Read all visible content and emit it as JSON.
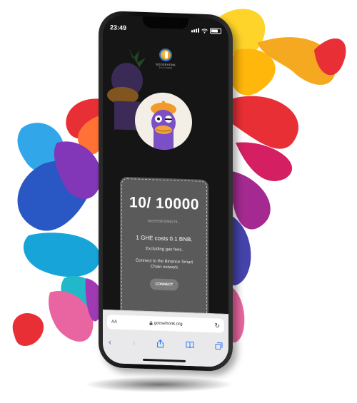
{
  "status_bar": {
    "time": "23:49"
  },
  "header": {
    "logo_title": "GOOSEHONK",
    "logo_subtitle": "EXCLUSIVES"
  },
  "mint_card": {
    "counter": "10/ 10000",
    "address": "0xc5755F3055274...",
    "price_text": "1 GHE costs 0.1 BNB.",
    "gas_text": "Excluding gas fees.",
    "network_text": "Connect to the Binance Smart Chain network",
    "connect_label": "CONNECT"
  },
  "browser": {
    "text_size_label": "AA",
    "url": "goosehonk.org",
    "toolbar_icons": [
      "back-icon",
      "forward-icon",
      "share-icon",
      "bookmarks-icon",
      "tabs-icon"
    ]
  },
  "colors": {
    "card_bg": "#5a5a5a",
    "screen_bg": "#151515",
    "ios_blue": "#3478f6",
    "duck_purple": "#7b4fc6",
    "beret_orange": "#f29b2a"
  }
}
